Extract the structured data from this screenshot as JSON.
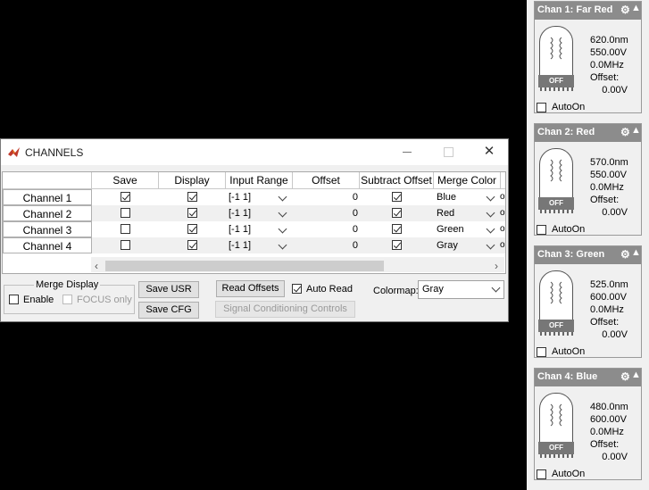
{
  "channels_window": {
    "title": "CHANNELS",
    "columns": [
      "Save",
      "Display",
      "Input Range",
      "Offset",
      "Subtract Offset",
      "Merge Color"
    ],
    "rows": [
      {
        "name": "Channel 1",
        "save": true,
        "display": true,
        "input_range": "[-1 1]",
        "offset": "0",
        "subtract_offset": true,
        "merge_color": "Blue",
        "clipped": "o"
      },
      {
        "name": "Channel 2",
        "save": false,
        "display": true,
        "input_range": "[-1 1]",
        "offset": "0",
        "subtract_offset": true,
        "merge_color": "Red",
        "clipped": "o"
      },
      {
        "name": "Channel 3",
        "save": false,
        "display": true,
        "input_range": "[-1 1]",
        "offset": "0",
        "subtract_offset": true,
        "merge_color": "Green",
        "clipped": "o"
      },
      {
        "name": "Channel 4",
        "save": false,
        "display": true,
        "input_range": "[-1 1]",
        "offset": "0",
        "subtract_offset": true,
        "merge_color": "Gray",
        "clipped": "o"
      }
    ],
    "merge_display": {
      "label": "Merge Display",
      "enable_label": "Enable",
      "enable_checked": false,
      "focus_only_label": "FOCUS only",
      "focus_only_checked": false
    },
    "buttons": {
      "save_usr": "Save USR",
      "save_cfg": "Save CFG",
      "read_offsets": "Read Offsets",
      "signal_conditioning": "Signal Conditioning Controls"
    },
    "auto_read": {
      "label": "Auto Read",
      "checked": true
    },
    "colormap": {
      "label": "Colormap:",
      "value": "Gray"
    }
  },
  "pmt_panel": {
    "cards": [
      {
        "title": "Chan 1: Far Red",
        "wavelength": "620.0nm",
        "voltage": "550.00V",
        "bandwidth": "0.0MHz",
        "offset_label": "Offset:",
        "offset": "0.00V",
        "state": "OFF",
        "autoon_label": "AutoOn",
        "autoon": false
      },
      {
        "title": "Chan 2: Red",
        "wavelength": "570.0nm",
        "voltage": "550.00V",
        "bandwidth": "0.0MHz",
        "offset_label": "Offset:",
        "offset": "0.00V",
        "state": "OFF",
        "autoon_label": "AutoOn",
        "autoon": false
      },
      {
        "title": "Chan 3: Green",
        "wavelength": "525.0nm",
        "voltage": "600.00V",
        "bandwidth": "0.0MHz",
        "offset_label": "Offset:",
        "offset": "0.00V",
        "state": "OFF",
        "autoon_label": "AutoOn",
        "autoon": false
      },
      {
        "title": "Chan 4: Blue",
        "wavelength": "480.0nm",
        "voltage": "600.00V",
        "bandwidth": "0.0MHz",
        "offset_label": "Offset:",
        "offset": "0.00V",
        "state": "OFF",
        "autoon_label": "AutoOn",
        "autoon": false
      }
    ]
  },
  "icons": [
    "matlab-icon",
    "minimize-icon",
    "maximize-icon",
    "close-icon",
    "gear-icon",
    "collapse-arrow-icon",
    "pmt-tube-icon",
    "chevron-down-icon",
    "scroll-left-icon",
    "scroll-right-icon"
  ]
}
